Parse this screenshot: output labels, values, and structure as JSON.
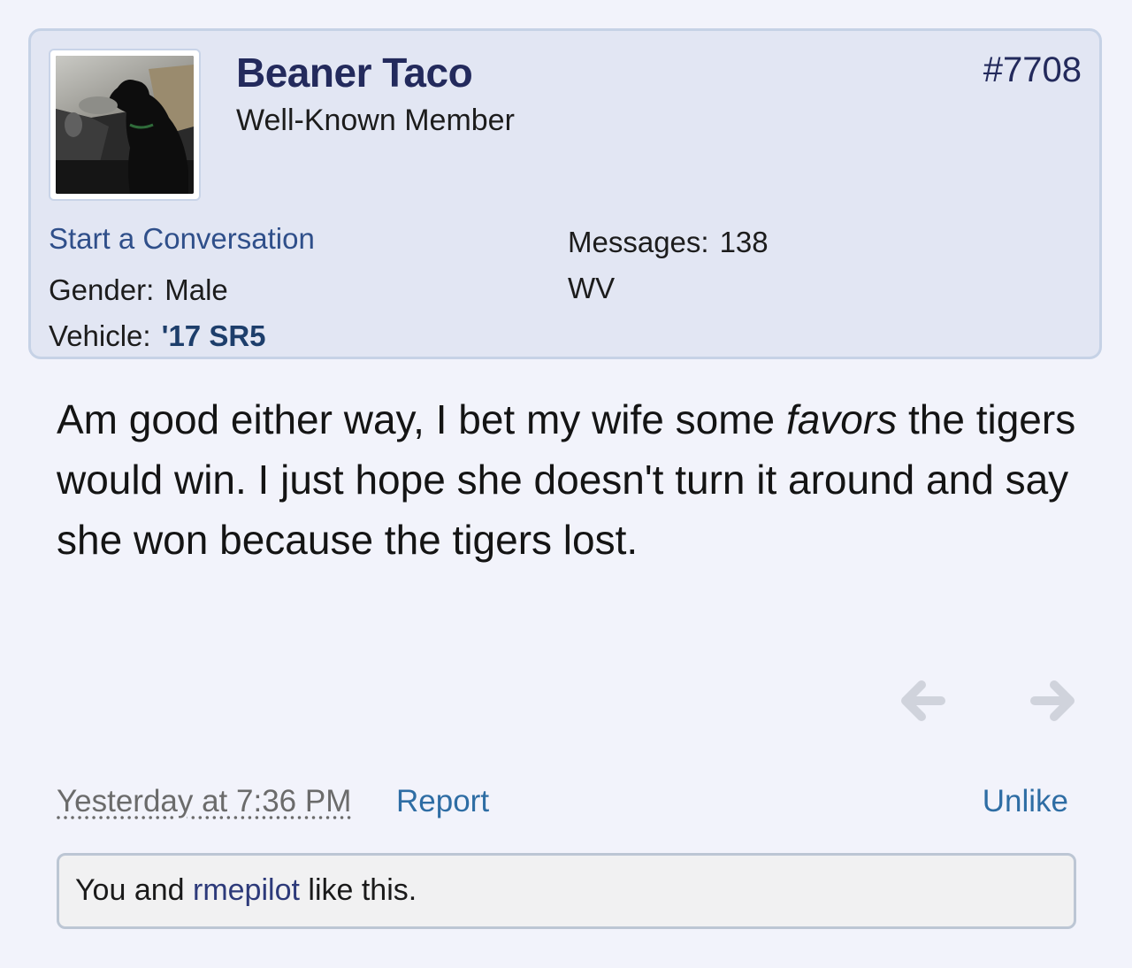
{
  "post": {
    "number": "#7708",
    "author": {
      "name": "Beaner Taco",
      "title": "Well-Known Member",
      "avatar_icon": "dog-in-car-photo"
    },
    "actions": {
      "start_conversation": "Start a Conversation"
    },
    "info": {
      "gender_label": "Gender:",
      "gender_value": "Male",
      "vehicle_label": "Vehicle:",
      "vehicle_value": "'17 SR5",
      "messages_label": "Messages:",
      "messages_value": "138",
      "location": "WV"
    },
    "message": {
      "part1": "Am good either way, I bet my wife some ",
      "emphasis": "favors",
      "part2": " the tigers would win. I just hope she doesn't turn it around and say she won because the tigers lost."
    },
    "nav": {
      "prev_icon": "arrow-left-icon",
      "next_icon": "arrow-right-icon"
    },
    "footer": {
      "timestamp": "Yesterday at 7:36 PM",
      "report": "Report",
      "unlike": "Unlike"
    },
    "likes": {
      "prefix": "You and ",
      "liker": "rmepilot",
      "suffix": " like this."
    }
  },
  "colors": {
    "card_background": "#e2e6f3",
    "card_border": "#c6d2e6",
    "page_background": "#f2f3fb",
    "username": "#232a5c",
    "link": "#2e6da4"
  }
}
